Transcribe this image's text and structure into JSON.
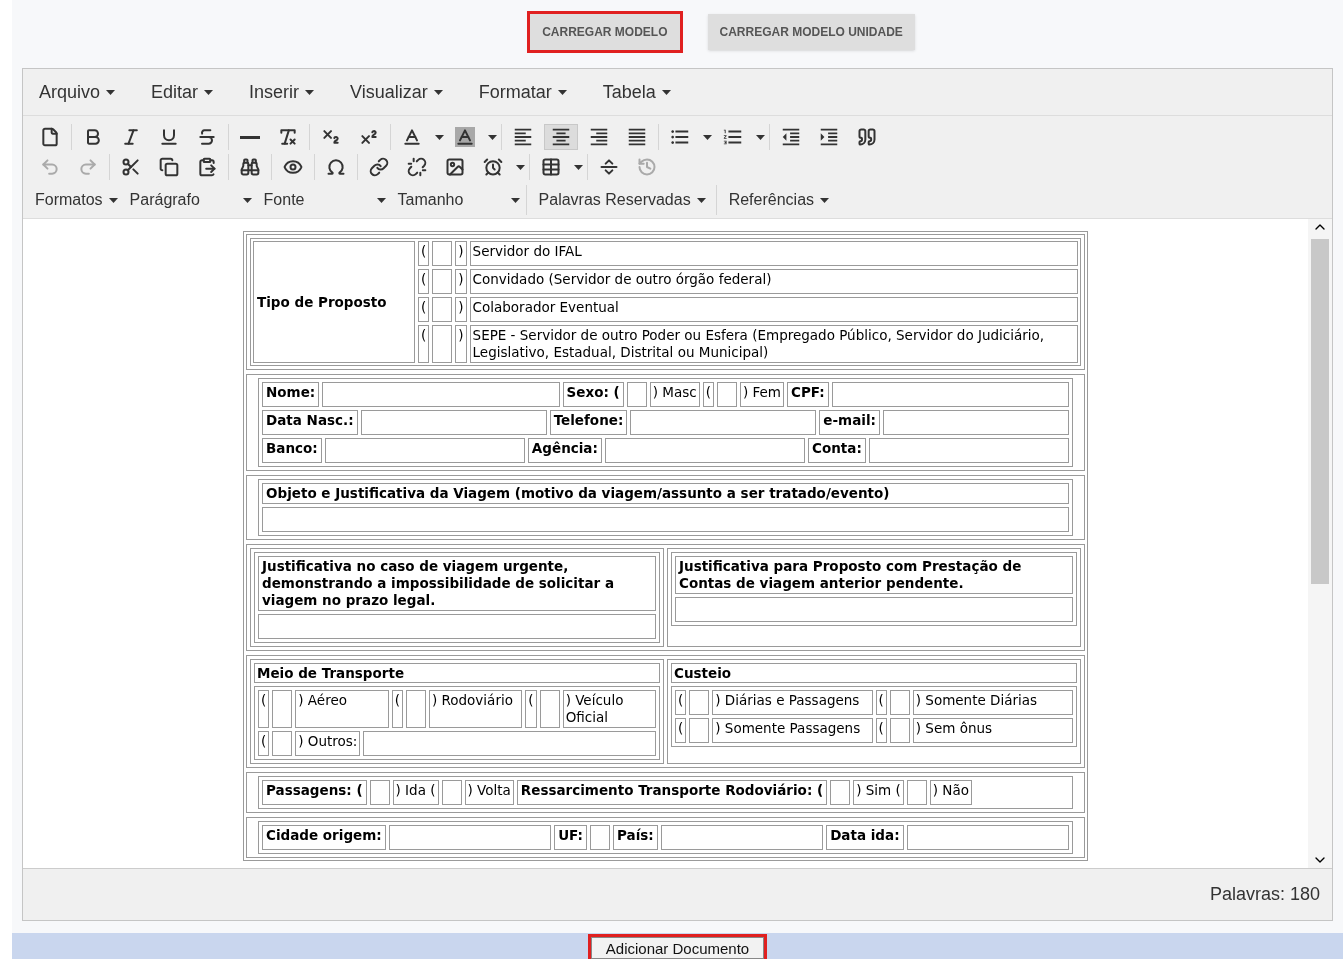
{
  "top_buttons": [
    {
      "label": "CARREGAR MODELO",
      "highlighted": true
    },
    {
      "label": "CARREGAR MODELO UNIDADE",
      "highlighted": false
    }
  ],
  "menu": [
    "Arquivo",
    "Editar",
    "Inserir",
    "Visualizar",
    "Formatar",
    "Tabela"
  ],
  "toolbar": [
    [
      [
        {
          "kind": "new",
          "active": false,
          "disabled": false
        }
      ],
      [
        {
          "kind": "bold",
          "active": false,
          "disabled": false
        },
        {
          "kind": "italic",
          "active": false,
          "disabled": false
        },
        {
          "kind": "underline",
          "active": false,
          "disabled": false
        },
        {
          "kind": "strike",
          "active": false,
          "disabled": false
        }
      ],
      [
        {
          "kind": "rule",
          "active": false,
          "disabled": false
        },
        {
          "kind": "clear",
          "active": false,
          "disabled": false
        }
      ],
      [
        {
          "kind": "sub",
          "active": false,
          "disabled": false
        },
        {
          "kind": "sup",
          "active": false,
          "disabled": false
        }
      ],
      [
        {
          "kind": "color",
          "active": false,
          "disabled": false
        },
        {
          "kind": "fill",
          "active": false,
          "disabled": false
        }
      ],
      [
        {
          "kind": "left",
          "active": false,
          "disabled": false
        },
        {
          "kind": "center",
          "active": true,
          "disabled": false
        },
        {
          "kind": "right",
          "active": false,
          "disabled": false
        },
        {
          "kind": "justify",
          "active": false,
          "disabled": false
        }
      ],
      [
        {
          "kind": "bullets",
          "active": false,
          "disabled": false
        },
        {
          "kind": "numbers",
          "active": false,
          "disabled": false
        }
      ],
      [
        {
          "kind": "outdent",
          "active": false,
          "disabled": false
        },
        {
          "kind": "indent",
          "active": false,
          "disabled": false
        },
        {
          "kind": "quote",
          "active": false,
          "disabled": false
        }
      ]
    ],
    [
      [
        {
          "kind": "undo",
          "active": false,
          "disabled": true
        },
        {
          "kind": "redo",
          "active": false,
          "disabled": true
        }
      ],
      [
        {
          "kind": "cut",
          "active": false,
          "disabled": false
        },
        {
          "kind": "copy",
          "active": false,
          "disabled": false
        },
        {
          "kind": "paste",
          "active": false,
          "disabled": false
        }
      ],
      [
        {
          "kind": "find",
          "active": false,
          "disabled": false
        }
      ],
      [
        {
          "kind": "preview",
          "active": false,
          "disabled": false
        }
      ],
      [
        {
          "kind": "omega",
          "active": false,
          "disabled": false
        }
      ],
      [
        {
          "kind": "link",
          "active": false,
          "disabled": false
        },
        {
          "kind": "unlink",
          "active": false,
          "disabled": false
        },
        {
          "kind": "image",
          "active": false,
          "disabled": false
        },
        {
          "kind": "clock",
          "active": false,
          "disabled": false
        }
      ],
      [
        {
          "kind": "table",
          "active": false,
          "disabled": false
        }
      ],
      [
        {
          "kind": "pagebreak",
          "active": false,
          "disabled": false
        },
        {
          "kind": "restore",
          "active": false,
          "disabled": true
        }
      ]
    ]
  ],
  "pickers": [
    {
      "label": "Formatos",
      "kind": "menu"
    },
    {
      "label": "Parágrafo",
      "kind": "select"
    },
    {
      "label": "Fonte",
      "kind": "select"
    },
    {
      "label": "Tamanho",
      "kind": "select"
    },
    {
      "label": "Palavras Reservadas",
      "kind": "menu"
    },
    {
      "label": "Referências",
      "kind": "menu"
    }
  ],
  "document": [
    {
      "kind": "labeled",
      "label": "Tipo de Proposto",
      "rows": [
        [
          {
            "kind": "text",
            "text": "("
          },
          {
            "kind": "box"
          },
          {
            "kind": "text",
            "text": ")"
          },
          {
            "kind": "line",
            "text": "Servidor do IFAL"
          }
        ],
        [
          {
            "kind": "text",
            "text": "("
          },
          {
            "kind": "box"
          },
          {
            "kind": "text",
            "text": ")"
          },
          {
            "kind": "line",
            "text": "Convidado (Servidor de outro órgão federal)"
          }
        ],
        [
          {
            "kind": "text",
            "text": "("
          },
          {
            "kind": "box"
          },
          {
            "kind": "text",
            "text": ")"
          },
          {
            "kind": "line",
            "text": "Colaborador Eventual"
          }
        ],
        [
          {
            "kind": "text",
            "text": "("
          },
          {
            "kind": "box"
          },
          {
            "kind": "text",
            "text": ")"
          },
          {
            "kind": "line",
            "text": "SEPE - Servidor de outro Poder ou Esfera (Empregado Público, Servidor do Judiciário, Legislativo, Estadual, Distrital ou Municipal)"
          }
        ]
      ]
    },
    {
      "kind": "rows",
      "rows": [
        [
          {
            "kind": "label",
            "text": "Nome:"
          },
          {
            "kind": "blank"
          },
          {
            "kind": "label",
            "text": "**Sexo:** ("
          },
          {
            "kind": "box"
          },
          {
            "kind": "text",
            "text": ") Masc"
          },
          {
            "kind": "text",
            "text": "("
          },
          {
            "kind": "box"
          },
          {
            "kind": "text",
            "text": ") Fem"
          },
          {
            "kind": "label",
            "text": "CPF:"
          },
          {
            "kind": "blank"
          }
        ],
        [
          {
            "kind": "label",
            "text": "Data Nasc.:"
          },
          {
            "kind": "blank"
          },
          {
            "kind": "label",
            "text": "Telefone:"
          },
          {
            "kind": "blank"
          },
          {
            "kind": "label",
            "text": "e-mail:"
          },
          {
            "kind": "blank"
          }
        ],
        [
          {
            "kind": "label",
            "text": "Banco:"
          },
          {
            "kind": "blank"
          },
          {
            "kind": "label",
            "text": "Agência:"
          },
          {
            "kind": "blank"
          },
          {
            "kind": "label",
            "text": "Conta:"
          },
          {
            "kind": "blank"
          }
        ]
      ]
    },
    {
      "kind": "rows",
      "rows": [
        [
          {
            "kind": "label",
            "text": "Objeto e Justificativa da Viagem (motivo da viagem/assunto a ser tratado/evento)"
          }
        ],
        [
          {
            "kind": "blank"
          }
        ]
      ]
    },
    {
      "kind": "columns",
      "columns": [
        {
          "rows": [
            [
              {
                "kind": "label",
                "text": "Justificativa no caso de viagem urgente, demonstrando a impossibilidade de solicitar a viagem no prazo legal."
              }
            ],
            [
              {
                "kind": "blank"
              }
            ]
          ]
        },
        {
          "rows": [
            [
              {
                "kind": "label",
                "text": "Justificativa para Proposto com Prestação de Contas de viagem anterior pendente."
              }
            ],
            [
              {
                "kind": "blank"
              }
            ]
          ]
        }
      ]
    },
    {
      "kind": "columns",
      "columns": [
        {
          "heading": "Meio de Transporte",
          "rows": [
            [
              {
                "kind": "text",
                "text": "("
              },
              {
                "kind": "box"
              },
              {
                "kind": "line",
                "text": ") Aéreo"
              },
              {
                "kind": "text",
                "text": "("
              },
              {
                "kind": "box"
              },
              {
                "kind": "line",
                "text": ") Rodoviário"
              },
              {
                "kind": "text",
                "text": "("
              },
              {
                "kind": "box"
              },
              {
                "kind": "line",
                "text": ") Veículo Oficial"
              }
            ],
            [
              {
                "kind": "text",
                "text": "("
              },
              {
                "kind": "box"
              },
              {
                "kind": "text",
                "text": ") Outros:"
              },
              {
                "kind": "blank"
              }
            ]
          ]
        },
        {
          "heading": "Custeio",
          "rows": [
            [
              {
                "kind": "text",
                "text": "("
              },
              {
                "kind": "box"
              },
              {
                "kind": "line",
                "text": ") Diárias e Passagens"
              },
              {
                "kind": "text",
                "text": "("
              },
              {
                "kind": "box"
              },
              {
                "kind": "line",
                "text": ") Somente Diárias"
              }
            ],
            [
              {
                "kind": "text",
                "text": "("
              },
              {
                "kind": "box"
              },
              {
                "kind": "line",
                "text": ") Somente Passagens"
              },
              {
                "kind": "text",
                "text": "("
              },
              {
                "kind": "box"
              },
              {
                "kind": "line",
                "text": ") Sem ônus"
              }
            ]
          ]
        }
      ]
    },
    {
      "kind": "rows",
      "rows": [
        [
          {
            "kind": "label",
            "text": "**Passagens:** ("
          },
          {
            "kind": "box"
          },
          {
            "kind": "text",
            "text": ") Ida ("
          },
          {
            "kind": "box"
          },
          {
            "kind": "text",
            "text": ") Volta"
          },
          {
            "kind": "label",
            "text": "**Ressarcimento Transporte Rodoviário:** ("
          },
          {
            "kind": "box"
          },
          {
            "kind": "text",
            "text": ") Sim ("
          },
          {
            "kind": "box"
          },
          {
            "kind": "text",
            "text": ") Não"
          }
        ]
      ]
    },
    {
      "kind": "rows",
      "rows": [
        [
          {
            "kind": "label",
            "text": "Cidade origem:"
          },
          {
            "kind": "blank"
          },
          {
            "kind": "label",
            "text": "UF:"
          },
          {
            "kind": "box"
          },
          {
            "kind": "label",
            "text": "País:"
          },
          {
            "kind": "blank"
          },
          {
            "kind": "label",
            "text": "Data ida:"
          },
          {
            "kind": "blank"
          }
        ]
      ]
    }
  ],
  "status": "Palavras: 180",
  "submit": {
    "label": "Adicionar Documento",
    "highlighted": true
  }
}
